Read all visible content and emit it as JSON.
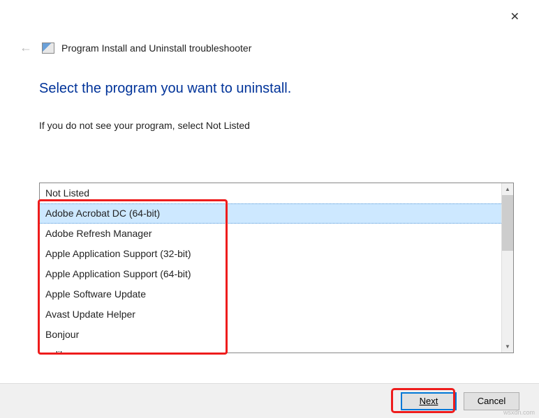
{
  "window": {
    "title": "Program Install and Uninstall troubleshooter"
  },
  "heading": "Select the program you want to uninstall.",
  "subtitle": "If you do not see your program, select Not Listed",
  "programs": {
    "items": [
      "Not Listed",
      "Adobe Acrobat DC (64-bit)",
      "Adobe Refresh Manager",
      "Apple Application Support (32-bit)",
      "Apple Application Support (64-bit)",
      "Apple Software Update",
      "Avast Update Helper",
      "Bonjour",
      "calibre"
    ],
    "selected_index": 1
  },
  "buttons": {
    "next": "Next",
    "cancel": "Cancel"
  },
  "watermark": "wsxdn.com"
}
